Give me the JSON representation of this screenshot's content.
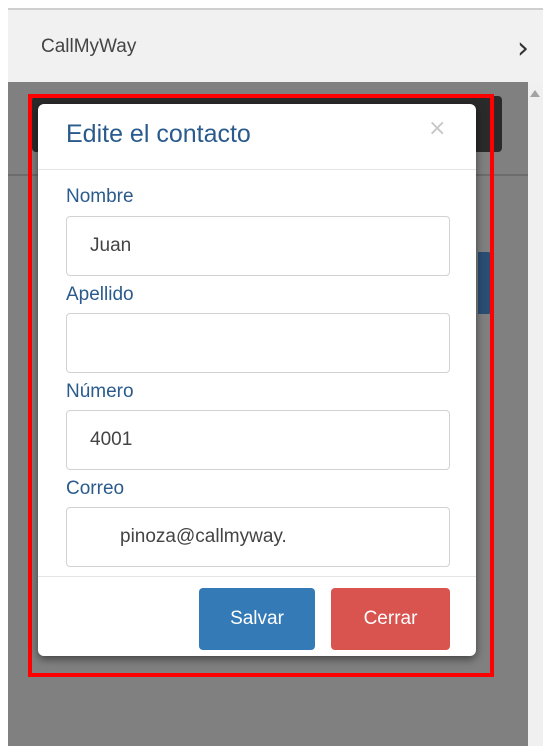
{
  "window": {
    "title": "CallMyWay",
    "forward_icon": "chevron-right-icon"
  },
  "modal": {
    "title": "Edite el contacto",
    "close_icon": "close-icon",
    "close_glyph": "×",
    "fields": [
      {
        "label": "Nombre",
        "value": "Juan",
        "placeholder": ""
      },
      {
        "label": "Apellido",
        "value": "",
        "placeholder": ""
      },
      {
        "label": "Número",
        "value": "4001",
        "placeholder": ""
      },
      {
        "label": "Correo",
        "value": "pinoza@callmyway.",
        "placeholder": ""
      }
    ],
    "buttons": {
      "save": "Salvar",
      "close": "Cerrar"
    }
  },
  "colors": {
    "primary": "#337ab7",
    "danger": "#d9534f",
    "title": "#2a5b8c",
    "highlight": "#ff0000",
    "backdrop": "#808080"
  }
}
